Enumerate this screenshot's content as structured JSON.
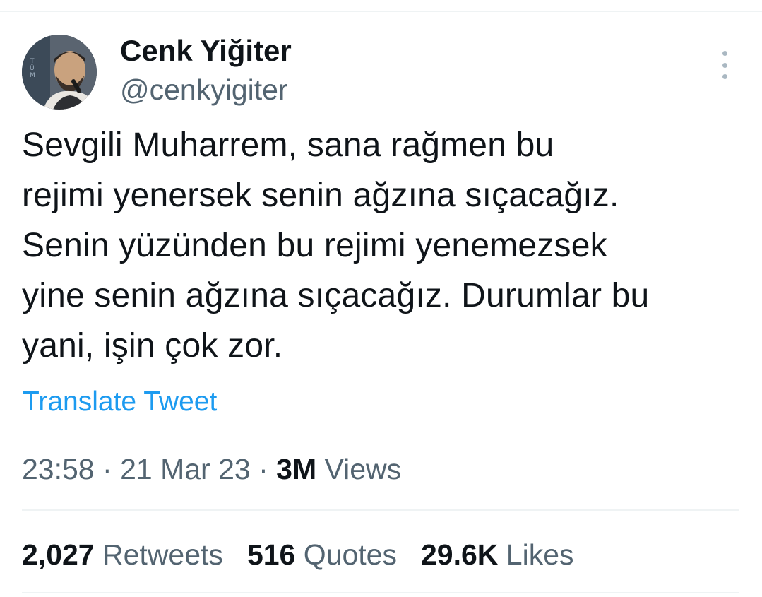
{
  "tweet": {
    "author": {
      "display_name": "Cenk Yiğiter",
      "handle": "@cenkyigiter"
    },
    "text": "Sevgili Muharrem, sana rağmen bu\nrejimi yenersek senin ağzına sıçacağız.\nSenin yüzünden bu rejimi yenemezsek\nyine senin ağzına sıçacağız. Durumlar bu\nyani, işin çok zor.",
    "translate_label": "Translate Tweet",
    "time": "23:58",
    "separator": "·",
    "date": "21 Mar 23",
    "views_count": "3M",
    "views_label": "Views",
    "stats": {
      "retweets_count": "2,027",
      "retweets_label": "Retweets",
      "quotes_count": "516",
      "quotes_label": "Quotes",
      "likes_count": "29.6K",
      "likes_label": "Likes"
    }
  },
  "icons": {
    "more": "more-vertical-icon",
    "avatar": "profile-photo"
  },
  "colors": {
    "link": "#1d9bf0",
    "secondary_text": "#536471",
    "primary_text": "#0f1419",
    "divider": "#eff3f4"
  }
}
